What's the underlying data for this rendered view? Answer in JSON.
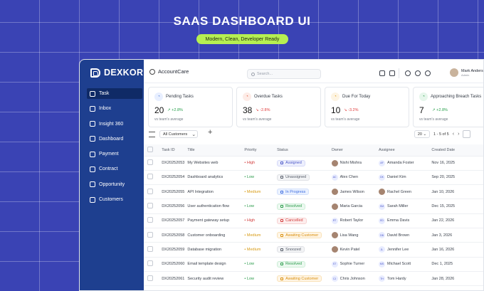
{
  "hero": {
    "title": "SAAS DASHBOARD UI",
    "tagline": "Modern, Clean, Developer Ready"
  },
  "brand": {
    "name": "DEXKOR"
  },
  "colors": {
    "sidebar": "#1e3f8f",
    "background": "#3a43b4",
    "accent": "#b6ef52"
  },
  "sidebar": {
    "items": [
      {
        "label": "Task",
        "icon": "task-icon",
        "active": true
      },
      {
        "label": "Inbox",
        "icon": "inbox-icon"
      },
      {
        "label": "Insight 360",
        "icon": "insight-icon"
      },
      {
        "label": "Dashboard",
        "icon": "dashboard-icon"
      },
      {
        "label": "Payment",
        "icon": "payment-icon"
      },
      {
        "label": "Contract",
        "icon": "contract-icon"
      },
      {
        "label": "Opportunity",
        "icon": "opportunity-icon"
      },
      {
        "label": "Customers",
        "icon": "customers-icon"
      }
    ]
  },
  "topbar": {
    "account": "AccountCare",
    "search_placeholder": "Search...",
    "user_name": "Mark Anders",
    "user_role": "Admin"
  },
  "stats": [
    {
      "label": "Pending Tasks",
      "value": "20",
      "delta": "+2.8%",
      "dir": "up",
      "sub": "vs team's average",
      "icon_color": "#4b7bd8",
      "icon_bg": "#e8efff"
    },
    {
      "label": "Overdue Tasks",
      "value": "38",
      "delta": "-2.8%",
      "dir": "down",
      "sub": "vs team's average",
      "icon_color": "#e25b3c",
      "icon_bg": "#fdece7"
    },
    {
      "label": "Due For Today",
      "value": "10",
      "delta": "-3.2%",
      "dir": "down",
      "sub": "vs team's average",
      "icon_color": "#e0a221",
      "icon_bg": "#fdf4e3"
    },
    {
      "label": "Approaching Breach Tasks",
      "value": "7",
      "delta": "+2.8%",
      "dir": "up",
      "sub": "vs team's average",
      "icon_color": "#2a9b4a",
      "icon_bg": "#e6f6eb"
    }
  ],
  "toolbar": {
    "filter_value": "All Customers",
    "page_size": "20",
    "page_range": "1 - 5 of 5"
  },
  "table": {
    "headers": [
      "Task ID",
      "Title",
      "Priority",
      "Status",
      "Owner",
      "Assignee",
      "Created Date"
    ],
    "rows": [
      {
        "id": "DX20252053",
        "title": "My Websites web",
        "priority": "High",
        "pclass": "high",
        "status": "Assigned",
        "sclass": "b-assigned",
        "owner": "Nishi Mishra",
        "otype": "photo",
        "oini": "",
        "assignee": "Amanda Foster",
        "atype": "ini",
        "aini": "AF",
        "date": "Nov 16, 2025"
      },
      {
        "id": "DX20252054",
        "title": "Dashboard analytics",
        "priority": "Low",
        "pclass": "low",
        "status": "Unassigned",
        "sclass": "b-unassigned",
        "owner": "Alex Chen",
        "otype": "ini",
        "oini": "AC",
        "assignee": "Daniel Kim",
        "atype": "ini",
        "aini": "DK",
        "date": "Sep 20, 2025"
      },
      {
        "id": "DX20252055",
        "title": "API Integration",
        "priority": "Medium",
        "pclass": "medium",
        "status": "In Progress",
        "sclass": "b-progress",
        "owner": "James Wilson",
        "otype": "photo",
        "oini": "",
        "assignee": "Rachel Green",
        "atype": "photo",
        "aini": "",
        "date": "Jan 10, 2026"
      },
      {
        "id": "DX20252056",
        "title": "User authentication flow",
        "priority": "Low",
        "pclass": "low",
        "status": "Resolved",
        "sclass": "b-resolved",
        "owner": "Maria Garcia",
        "otype": "photo",
        "oini": "",
        "assignee": "Sarah Miller",
        "atype": "ini",
        "aini": "SM",
        "date": "Dec 15, 2025"
      },
      {
        "id": "DX20252057",
        "title": "Payment gateway setup",
        "priority": "High",
        "pclass": "high",
        "status": "Cancelled",
        "sclass": "b-cancelled",
        "owner": "Robert Taylor",
        "otype": "ini",
        "oini": "RT",
        "assignee": "Emma Davis",
        "atype": "ini",
        "aini": "ED",
        "date": "Jan 22, 2026"
      },
      {
        "id": "DX20252058",
        "title": "Customer onboarding",
        "priority": "Medium",
        "pclass": "medium",
        "status": "Awaiting Customer",
        "sclass": "b-awaiting",
        "owner": "Lisa Wang",
        "otype": "photo",
        "oini": "",
        "assignee": "David Brown",
        "atype": "ini",
        "aini": "DB",
        "date": "Jan 3, 2026"
      },
      {
        "id": "DX20252059",
        "title": "Database migration",
        "priority": "Medium",
        "pclass": "medium",
        "status": "Snoozed",
        "sclass": "b-snoozed",
        "owner": "Kevin Patel",
        "otype": "photo",
        "oini": "",
        "assignee": "Jennifer Lee",
        "atype": "ini",
        "aini": "JL",
        "date": "Jan 16, 2026"
      },
      {
        "id": "DX20252060",
        "title": "Email template design",
        "priority": "Low",
        "pclass": "low",
        "status": "Resolved",
        "sclass": "b-resolved",
        "owner": "Sophie Turner",
        "otype": "ini",
        "oini": "ST",
        "assignee": "Michael Scott",
        "atype": "ini",
        "aini": "MS",
        "date": "Dec 1, 2025"
      },
      {
        "id": "DX20252061",
        "title": "Security audit review",
        "priority": "Low",
        "pclass": "low",
        "status": "Awaiting Customer",
        "sclass": "b-awaiting",
        "owner": "Chris Johnson",
        "otype": "ini",
        "oini": "CJ",
        "assignee": "Tom Hardy",
        "atype": "ini",
        "aini": "TH",
        "date": "Jan 28, 2026"
      }
    ]
  }
}
